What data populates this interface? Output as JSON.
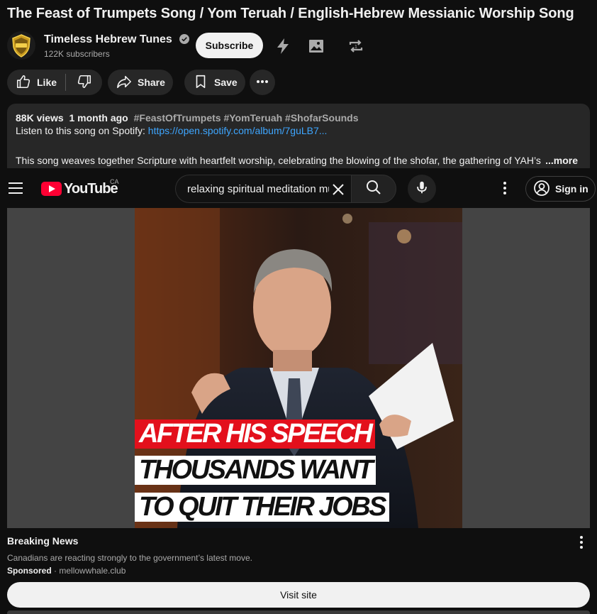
{
  "video": {
    "title": "The Feast of Trumpets Song / Yom Teruah / English-Hebrew Messianic Worship Song"
  },
  "channel": {
    "name": "Timeless Hebrew Tunes",
    "subscribers": "122K subscribers",
    "subscribe_label": "Subscribe",
    "verified_icon": "verified-check-icon"
  },
  "actions": {
    "like_label": "Like",
    "share_label": "Share",
    "save_label": "Save"
  },
  "description": {
    "views": "88K views",
    "age": "1 month ago",
    "tags": "#FeastOfTrumpets #YomTeruah #ShofarSounds",
    "spotify_prefix": "Listen to this song on Spotify: ",
    "spotify_link": "https://open.spotify.com/album/7guLB7...",
    "body": "This song weaves together Scripture with heartfelt worship, celebrating the blowing of the shofar, the gathering of YAH’s",
    "more_label": "...more"
  },
  "masthead": {
    "logo_text": "YouTube",
    "country_code": "CA",
    "search_value": "relaxing spiritual meditation music",
    "signin_label": "Sign in"
  },
  "ad": {
    "headline_lines": [
      "AFTER HIS SPEECH",
      "THOUSANDS WANT",
      "TO QUIT THEIR JOBS"
    ],
    "title": "Breaking News",
    "description": "Canadians are reacting strongly to the government’s latest move.",
    "sponsored_label": "Sponsored",
    "separator": "·",
    "domain": "mellowwhale.club",
    "cta_label": "Visit site"
  },
  "colors": {
    "background": "#0f0f0f",
    "surface": "#272727",
    "link": "#3ea6ff",
    "brand_red": "#ff0033",
    "headline_red": "#e3101c"
  }
}
